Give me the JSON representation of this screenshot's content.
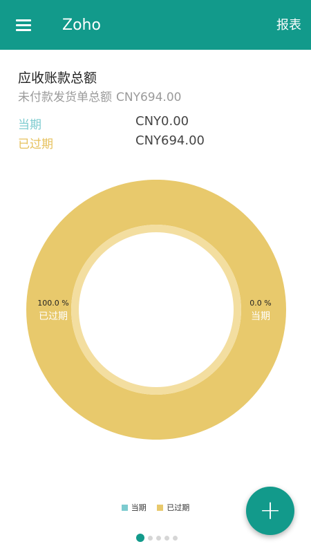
{
  "appbar": {
    "title": "Zoho",
    "report_label": "报表",
    "color": "#129a8b"
  },
  "summary": {
    "title": "应收账款总额",
    "subtitle_label": "未付款发货单总额",
    "subtitle_amount": "CNY694.00"
  },
  "rows": [
    {
      "label": "当期",
      "value": "CNY0.00",
      "color": "#7ccbcf"
    },
    {
      "label": "已过期",
      "value": "CNY694.00",
      "color": "#e6c15c"
    }
  ],
  "chart_data": {
    "type": "pie",
    "categories": [
      "当期",
      "已过期"
    ],
    "values": [
      0.0,
      100.0
    ],
    "colors": [
      "#7ccbcf",
      "#e8c96c"
    ],
    "slice_labels": [
      {
        "percent": "0.0 %",
        "name": "当期"
      },
      {
        "percent": "100.0 %",
        "name": "已过期"
      }
    ],
    "legend": {
      "position": "bottom",
      "entries": [
        "当期",
        "已过期"
      ]
    }
  },
  "fab": {
    "icon": "plus-icon",
    "label": "+"
  },
  "pager": {
    "count": 5,
    "active": 0
  }
}
